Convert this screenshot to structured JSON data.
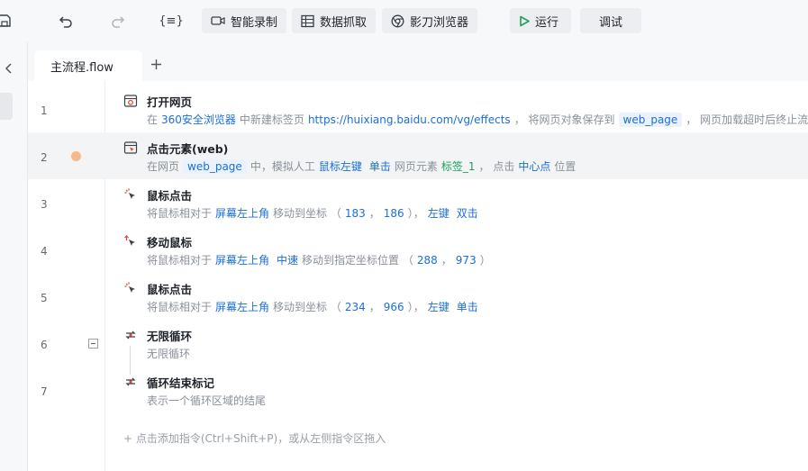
{
  "toolbar": {
    "smart_record": "智能录制",
    "data_capture": "数据抓取",
    "browser": "影刀浏览器",
    "run": "运行",
    "debug": "调试",
    "expr_icon_text": "{≡}",
    "run_color": "#1fa25a"
  },
  "tabs": {
    "active": "主流程.flow",
    "add": "+"
  },
  "commands": [
    {
      "line": "1",
      "title": "打开网页",
      "icon": "browser-window-icon",
      "desc": [
        {
          "t": "text",
          "v": "在"
        },
        {
          "t": "kw",
          "v": "360安全浏览器"
        },
        {
          "t": "text",
          "v": "中新建标签页"
        },
        {
          "t": "kw",
          "v": "https://huixiang.baidu.com/vg/effects"
        },
        {
          "t": "text",
          "v": "， 将网页对象保存到"
        },
        {
          "t": "chip",
          "v": "web_page"
        },
        {
          "t": "text",
          "v": "， 网页加载超时后终止流程"
        }
      ]
    },
    {
      "line": "2",
      "title": "点击元素(web)",
      "icon": "click-element-icon",
      "breakpoint": true,
      "desc": [
        {
          "t": "text",
          "v": "在网页"
        },
        {
          "t": "chip",
          "v": "web_page"
        },
        {
          "t": "text",
          "v": "中，模拟人工"
        },
        {
          "t": "kw",
          "v": "鼠标左键"
        },
        {
          "t": "kw",
          "v": "单击"
        },
        {
          "t": "text",
          "v": "网页元素"
        },
        {
          "t": "chipg",
          "v": "标签_1"
        },
        {
          "t": "text",
          "v": "， 点击"
        },
        {
          "t": "kw",
          "v": "中心点"
        },
        {
          "t": "text",
          "v": "位置"
        }
      ]
    },
    {
      "line": "3",
      "title": "鼠标点击",
      "icon": "mouse-click-icon",
      "desc": [
        {
          "t": "text",
          "v": "将鼠标相对于"
        },
        {
          "t": "kw",
          "v": "屏幕左上角"
        },
        {
          "t": "text",
          "v": "移动到坐标 （"
        },
        {
          "t": "kw",
          "v": "183"
        },
        {
          "t": "text",
          "v": "，"
        },
        {
          "t": "kw",
          "v": "186"
        },
        {
          "t": "text",
          "v": "），"
        },
        {
          "t": "kw",
          "v": "左键"
        },
        {
          "t": "kw",
          "v": "双击"
        }
      ]
    },
    {
      "line": "4",
      "title": "移动鼠标",
      "icon": "mouse-move-icon",
      "desc": [
        {
          "t": "text",
          "v": "将鼠标相对于"
        },
        {
          "t": "kw",
          "v": "屏幕左上角"
        },
        {
          "t": "kw",
          "v": "中速"
        },
        {
          "t": "text",
          "v": "移动到指定坐标位置 （"
        },
        {
          "t": "kw",
          "v": "288"
        },
        {
          "t": "text",
          "v": "，"
        },
        {
          "t": "kw",
          "v": "973"
        },
        {
          "t": "text",
          "v": "）"
        }
      ]
    },
    {
      "line": "5",
      "title": "鼠标点击",
      "icon": "mouse-click-icon",
      "desc": [
        {
          "t": "text",
          "v": "将鼠标相对于"
        },
        {
          "t": "kw",
          "v": "屏幕左上角"
        },
        {
          "t": "text",
          "v": "移动到坐标 （"
        },
        {
          "t": "kw",
          "v": "234"
        },
        {
          "t": "text",
          "v": "，"
        },
        {
          "t": "kw",
          "v": "966"
        },
        {
          "t": "text",
          "v": "），"
        },
        {
          "t": "kw",
          "v": "左键"
        },
        {
          "t": "kw",
          "v": "单击"
        }
      ]
    },
    {
      "line": "6",
      "title": "无限循环",
      "icon": "loop-icon",
      "fold": true,
      "desc": [
        {
          "t": "text",
          "v": "无限循环"
        }
      ]
    },
    {
      "line": "7",
      "title": "循环结束标记",
      "icon": "loop-end-icon",
      "desc": [
        {
          "t": "text",
          "v": "表示一个循环区域的结尾"
        }
      ]
    }
  ],
  "add_hint": "+ 点击添加指令(Ctrl+Shift+P)，或从左侧指令区拖入"
}
